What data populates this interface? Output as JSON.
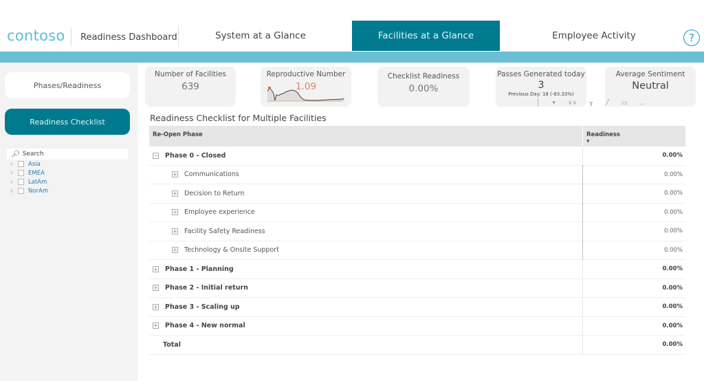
{
  "header": {
    "logo": "contoso",
    "app_title": "Readiness Dashboard",
    "tabs": [
      {
        "label": "System at a Glance",
        "active": false
      },
      {
        "label": "Facilities at a Glance",
        "active": true
      },
      {
        "label": "Employee Activity",
        "active": false
      }
    ],
    "help_icon": "?"
  },
  "colors": {
    "brand_teal": "#007a8f",
    "header_band": "#6bbfd4",
    "logo": "#5cbfd4",
    "sparkline_value": "#e0826c"
  },
  "sidebar": {
    "buttons": [
      {
        "label": "Phases/Readiness",
        "selected": false
      },
      {
        "label": "Readiness Checklist",
        "selected": true
      }
    ],
    "slicer": {
      "search_placeholder": "Search",
      "items": [
        {
          "label": "Asia",
          "checked": false
        },
        {
          "label": "EMEA",
          "checked": false
        },
        {
          "label": "LatAm",
          "checked": false
        },
        {
          "label": "NorAm",
          "checked": false
        }
      ]
    }
  },
  "kpis": {
    "facilities": {
      "title": "Number of Facilities",
      "value": "639"
    },
    "reproductive": {
      "title": "Reproductive Number",
      "value": "1.09"
    },
    "checklist": {
      "title": "Checklist Readiness",
      "value": "0.00%"
    },
    "passes": {
      "title": "Passes Generated today",
      "value": "3",
      "sub": "Previous Day: 18 (-83.33%)"
    },
    "sentiment": {
      "title": "Average Sentiment",
      "value": "Neutral"
    }
  },
  "matrix": {
    "title": "Readiness Checklist for Multiple Facilities",
    "columns": [
      "Re-Open Phase",
      "Readiness"
    ],
    "rows": [
      {
        "type": "phase",
        "label": "Phase 0 - Closed",
        "value": "0.00%",
        "expanded": true
      },
      {
        "type": "child",
        "label": "Communications",
        "value": "0.00%"
      },
      {
        "type": "child",
        "label": "Decision to Return",
        "value": "0.00%"
      },
      {
        "type": "child",
        "label": "Employee experience",
        "value": "0.00%"
      },
      {
        "type": "child",
        "label": "Facility Safety Readiness",
        "value": "0.00%"
      },
      {
        "type": "child",
        "label": "Technology & Onsite Support",
        "value": "0.00%"
      },
      {
        "type": "phase",
        "label": "Phase 1 - Planning",
        "value": "0.00%",
        "expanded": false
      },
      {
        "type": "phase",
        "label": "Phase 2 - Initial return",
        "value": "0.00%",
        "expanded": false
      },
      {
        "type": "phase",
        "label": "Phase 3 - Scaling up",
        "value": "0.00%",
        "expanded": false
      },
      {
        "type": "phase",
        "label": "Phase 4 - New normal",
        "value": "0.00%",
        "expanded": false
      },
      {
        "type": "total",
        "label": "Total",
        "value": "0.00%"
      }
    ]
  }
}
